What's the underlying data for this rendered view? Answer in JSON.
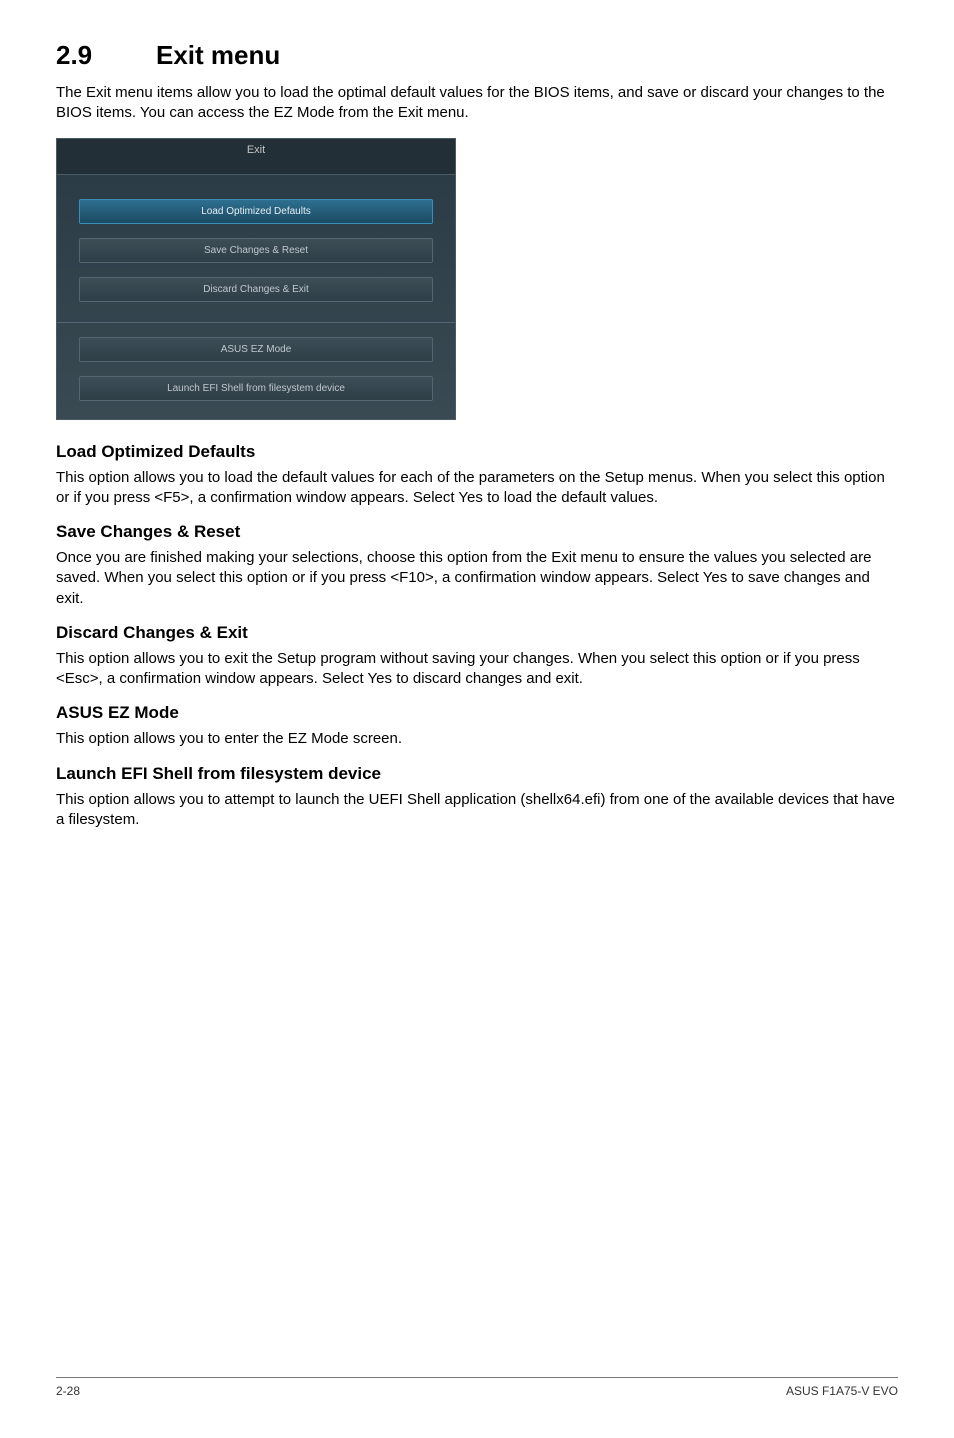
{
  "heading": {
    "num": "2.9",
    "title": "Exit menu"
  },
  "intro": "The Exit menu items allow you to load the optimal default values for the BIOS items, and save or discard your changes to the BIOS items. You can access the EZ Mode from the Exit menu.",
  "dialog": {
    "title": "Exit",
    "buttons_top": [
      {
        "label": "Load Optimized Defaults",
        "selected": true
      },
      {
        "label": "Save Changes & Reset",
        "selected": false
      },
      {
        "label": "Discard Changes & Exit",
        "selected": false
      }
    ],
    "buttons_bottom": [
      {
        "label": "ASUS EZ Mode",
        "selected": false
      },
      {
        "label": "Launch EFI Shell from filesystem device",
        "selected": false
      }
    ]
  },
  "sections": {
    "load_defaults": {
      "title": "Load Optimized Defaults",
      "body": "This option allows you to load the default values for each of the parameters on the Setup menus. When you select this option or if you press <F5>, a confirmation window appears. Select Yes to load the default values."
    },
    "save_reset": {
      "title": "Save Changes & Reset",
      "body": "Once you are finished making your selections, choose this option from the Exit menu to ensure the values you selected are saved. When you select this option or if you press <F10>, a confirmation window appears. Select Yes to save changes and exit."
    },
    "discard_exit": {
      "title": "Discard Changes & Exit",
      "body": "This option allows you to exit the Setup program without saving your changes. When you select this option or if you press <Esc>, a confirmation window appears. Select Yes to discard changes and exit."
    },
    "ez_mode": {
      "title": "ASUS EZ Mode",
      "body": "This option allows you to enter the EZ Mode screen."
    },
    "launch_efi": {
      "title": "Launch EFI Shell from filesystem device",
      "body": "This option allows you to attempt to launch the UEFI Shell application (shellx64.efi) from one of the available devices that have a filesystem."
    }
  },
  "footer": {
    "page": "2-28",
    "product": "ASUS F1A75-V EVO"
  }
}
